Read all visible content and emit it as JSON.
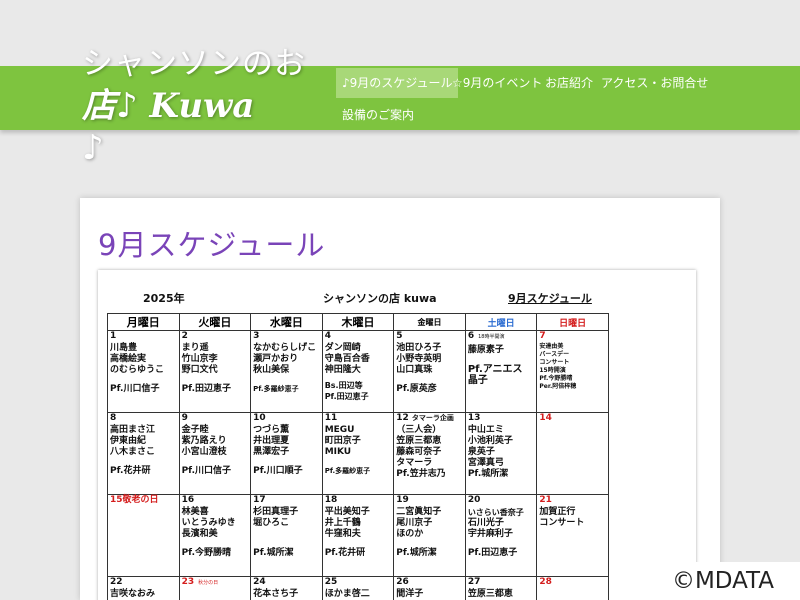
{
  "site": {
    "logo_line1": "シャンソンのお",
    "logo_line2": "店♪ Kuwa",
    "logo_line3": "♪"
  },
  "nav": {
    "items": [
      {
        "label": "♪9月のスケジュール"
      },
      {
        "label": "☆9月のイベント"
      },
      {
        "label": "お店紹介"
      },
      {
        "label": "アクセス・お問合せ"
      },
      {
        "label": "設備のご案内"
      }
    ]
  },
  "main": {
    "title": "9月スケジュール"
  },
  "sheet": {
    "year": "2025年",
    "shop": "シャンソンの店 kuwa",
    "title": "9月スケジュール",
    "weekdays": [
      "月曜日",
      "火曜日",
      "水曜日",
      "木曜日",
      "金曜日",
      "土曜日",
      "日曜日"
    ],
    "week1": {
      "mon": {
        "day": "1",
        "l1": "川島豊",
        "l2": "高橋絵実",
        "l3": "のむらゆうこ",
        "pf": "Pf.川口信子"
      },
      "tue": {
        "day": "2",
        "l1": "まり遥",
        "l2": "竹山京李",
        "l3": "野口文代",
        "pf": "Pf.田辺恵子"
      },
      "wed": {
        "day": "3",
        "l1": "なかむらしげこ",
        "l2": "瀬戸かおり",
        "l3": "秋山美保",
        "pf": "Pf.多羅紗恵子"
      },
      "thu": {
        "day": "4",
        "l1": "ダン岡崎",
        "l2": "守島百合香",
        "l3": "神田隆大",
        "l4": "Bs.田辺等",
        "pf": "Pf.田辺恵子"
      },
      "fri": {
        "day": "5",
        "l1": "池田ひろ子",
        "l2": "小野寺英明",
        "l3": "山口真珠",
        "pf": "Pf.原英彦"
      },
      "sat": {
        "day": "6",
        "note": "18時半開演",
        "l1": "藤原素子",
        "l2": "Pf.アニエス",
        "l3": "晶子"
      },
      "sun": {
        "day": "7",
        "l1": "安達由美",
        "l2": "バースデー",
        "l3": "コンサート",
        "l4": "15時開演",
        "l5": "Pf.今野勝晴",
        "l6": "Per.阿倍梓穂"
      }
    },
    "week2": {
      "mon": {
        "day": "8",
        "l1": "高田まさ江",
        "l2": "伊東由紀",
        "l3": "八木まさこ",
        "pf": "Pf.花井研"
      },
      "tue": {
        "day": "9",
        "l1": "金子睦",
        "l2": "紫乃路えり",
        "l3": "小宮山澄枝",
        "pf": "Pf.川口信子"
      },
      "wed": {
        "day": "10",
        "l1": "つづら薫",
        "l2": "井出理夏",
        "l3": "黒澤宏子",
        "pf": "Pf.川口順子"
      },
      "thu": {
        "day": "11",
        "l1": "MEGU",
        "l2": "町田京子",
        "l3": "MIKU",
        "pf": "Pf.多羅紗恵子"
      },
      "fri": {
        "day": "12",
        "note": "タマーラ企画",
        "l1": "（三人会）",
        "l2": "笠原三都恵",
        "l3": "藤森可奈子",
        "l4": "タマーラ",
        "pf": "Pf.笠井志乃"
      },
      "sat": {
        "day": "13",
        "l1": "中山エミ",
        "l2": "小池利英子",
        "l3": "泉英子",
        "l4": "宮澤真弓",
        "pf": "Pf.城所潔"
      },
      "sun": {
        "day": "14"
      }
    },
    "week3": {
      "mon": {
        "day": "15",
        "note": "敬老の日"
      },
      "tue": {
        "day": "16",
        "l1": "林美喜",
        "l2": "いとうみゆき",
        "l3": "長濱和美",
        "pf": "Pf.今野勝晴"
      },
      "wed": {
        "day": "17",
        "l1": "杉田真理子",
        "l2": "堀ひろこ",
        "pf": "Pf.城所潔"
      },
      "thu": {
        "day": "18",
        "l1": "平出美知子",
        "l2": "井上千鶴",
        "l3": "牛窪和夫",
        "pf": "Pf.花井研"
      },
      "fri": {
        "day": "19",
        "l1": "二宮眞知子",
        "l2": "尾川京子",
        "l3": "ほのか",
        "pf": "Pf.城所潔"
      },
      "sat": {
        "day": "20",
        "l1": "いさらい香奈子",
        "l2": "石川光子",
        "l3": "宇井麻利子",
        "pf": "Pf.田辺恵子"
      },
      "sun": {
        "day": "21",
        "l1": "加賀正行",
        "l2": "コンサート"
      }
    },
    "week4": {
      "mon": {
        "day": "22",
        "l1": "吉咲なおみ"
      },
      "tue": {
        "day": "23",
        "note": "秋分の日"
      },
      "wed": {
        "day": "24",
        "l1": "花本さち子"
      },
      "thu": {
        "day": "25",
        "l1": "ほかま啓二"
      },
      "fri": {
        "day": "26",
        "l1": "間洋子"
      },
      "sat": {
        "day": "27",
        "l1": "笠原三都恵"
      },
      "sun": {
        "day": "28"
      }
    }
  },
  "watermark": "©MDATA",
  "colors": {
    "green": "#7ec43f",
    "title_purple": "#7a44b8",
    "red": "#d41c1c",
    "blue": "#2a6bd1"
  }
}
